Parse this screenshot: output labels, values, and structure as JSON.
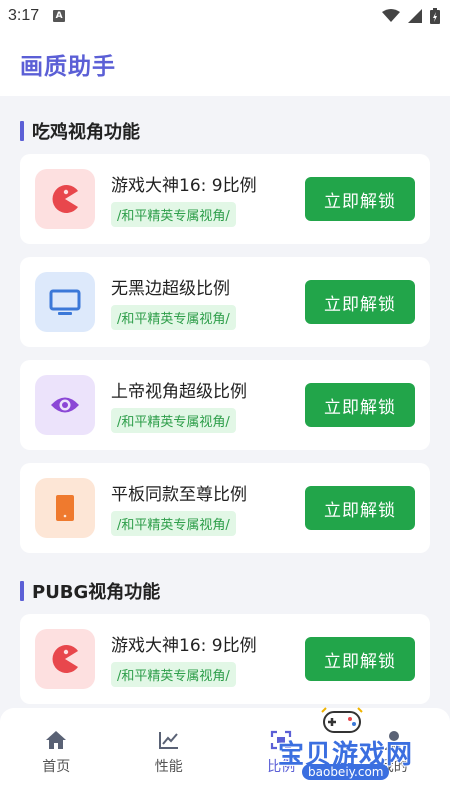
{
  "status_bar": {
    "time": "3:17",
    "app_badge": "A"
  },
  "app": {
    "title": "画质助手"
  },
  "sections": [
    {
      "title": "吃鸡视角功能",
      "items": [
        {
          "name": "游戏大神16: 9比例",
          "tag": "/和平精英专属视角/",
          "button": "立即解锁",
          "icon": "pacman-icon",
          "icon_bg": "#fde0e0",
          "icon_color": "#e8474c"
        },
        {
          "name": "无黑边超级比例",
          "tag": "/和平精英专属视角/",
          "button": "立即解锁",
          "icon": "monitor-icon",
          "icon_bg": "#dde9fb",
          "icon_color": "#3b78d8"
        },
        {
          "name": "上帝视角超级比例",
          "tag": "/和平精英专属视角/",
          "button": "立即解锁",
          "icon": "eye-icon",
          "icon_bg": "#ece3fb",
          "icon_color": "#8b47d6"
        },
        {
          "name": "平板同款至尊比例",
          "tag": "/和平精英专属视角/",
          "button": "立即解锁",
          "icon": "tablet-icon",
          "icon_bg": "#fde6d6",
          "icon_color": "#ef7a2e"
        }
      ]
    },
    {
      "title": "PUBG视角功能",
      "items": [
        {
          "name": "游戏大神16: 9比例",
          "tag": "/和平精英专属视角/",
          "button": "立即解锁",
          "icon": "pacman-icon",
          "icon_bg": "#fde0e0",
          "icon_color": "#e8474c"
        }
      ]
    }
  ],
  "bottom_nav": [
    {
      "label": "首页",
      "icon": "home-icon"
    },
    {
      "label": "性能",
      "icon": "chart-icon"
    },
    {
      "label": "比例",
      "icon": "ratio-icon"
    },
    {
      "label": "我的",
      "icon": "profile-icon"
    }
  ],
  "watermark": {
    "title": "宝贝游戏网",
    "url": "baobeiy.com"
  },
  "colors": {
    "accent": "#5b5fd6",
    "button": "#22a54a",
    "tag_text": "#2e9e4a",
    "tag_bg": "#e2f7e6"
  }
}
